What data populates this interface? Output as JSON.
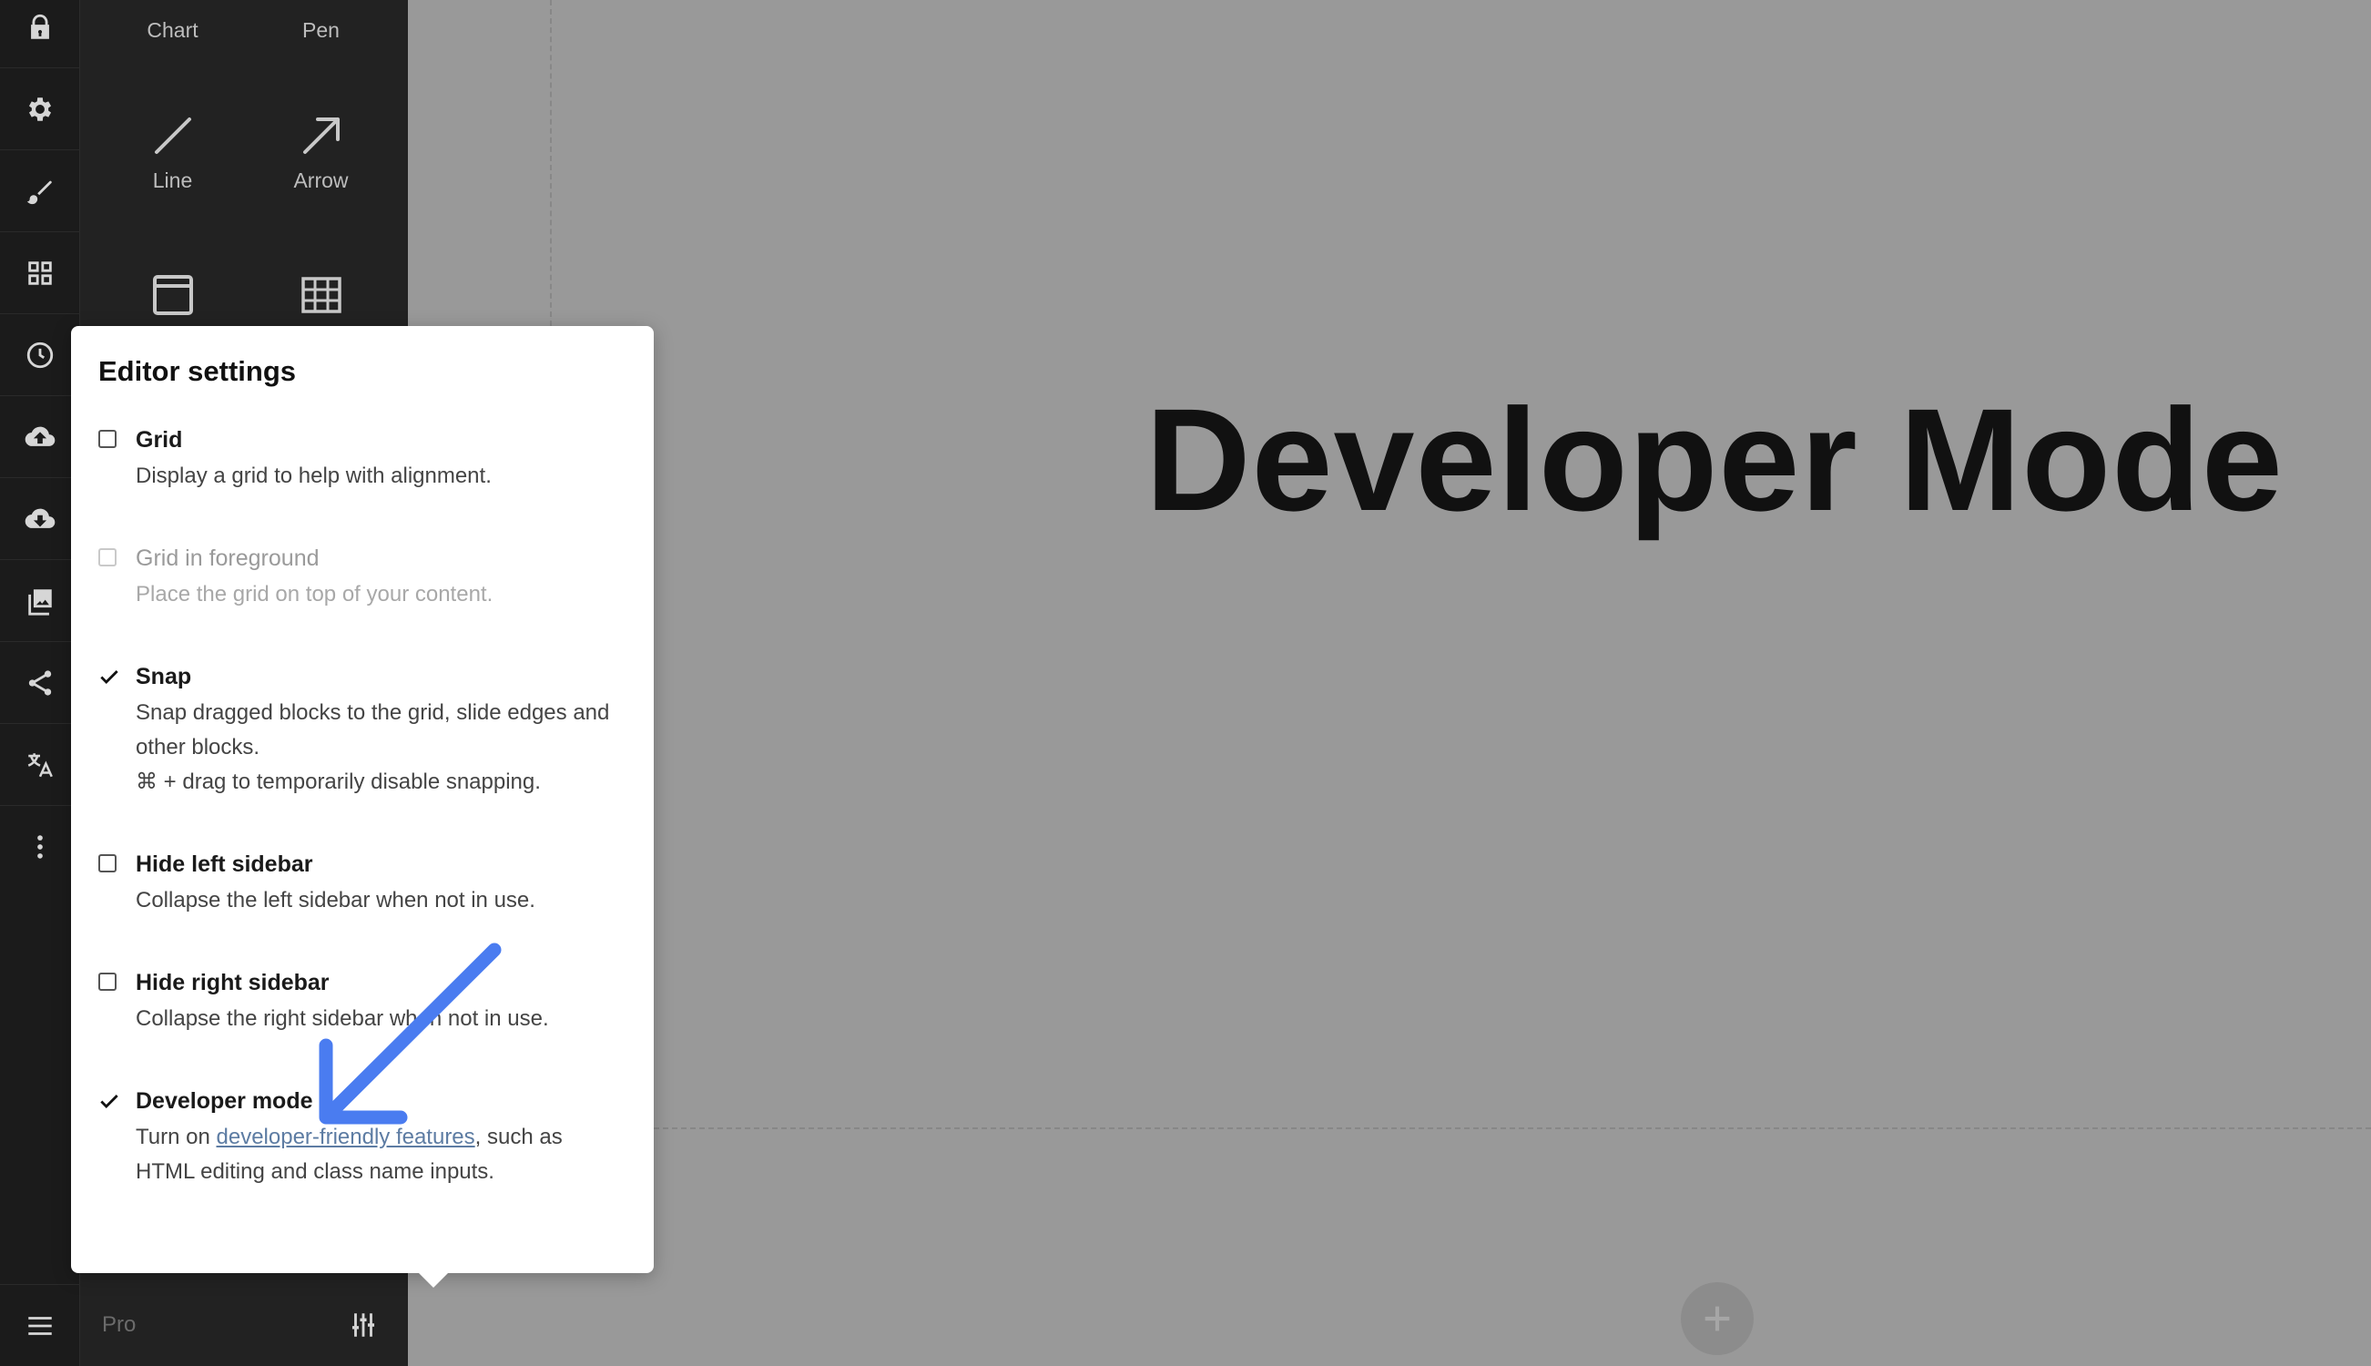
{
  "canvas": {
    "heading": "Developer Mode"
  },
  "tools": {
    "chart_label": "Chart",
    "pen_label": "Pen",
    "line_label": "Line",
    "arrow_label": "Arrow"
  },
  "footer": {
    "pro_label": "Pro"
  },
  "settings": {
    "title": "Editor settings",
    "options": [
      {
        "label": "Grid",
        "desc": "Display a grid to help with alignment.",
        "checked": false,
        "disabled": false
      },
      {
        "label": "Grid in foreground",
        "desc": "Place the grid on top of your content.",
        "checked": false,
        "disabled": true
      },
      {
        "label": "Snap",
        "desc": "Snap dragged blocks to the grid, slide edges and other blocks.",
        "desc2": "⌘ + drag to temporarily disable snapping.",
        "checked": true,
        "disabled": false
      },
      {
        "label": "Hide left sidebar",
        "desc": "Collapse the left sidebar when not in use.",
        "checked": false,
        "disabled": false
      },
      {
        "label": "Hide right sidebar",
        "desc": "Collapse the right sidebar when not in use.",
        "checked": false,
        "disabled": false
      },
      {
        "label": "Developer mode",
        "desc_pre": "Turn on ",
        "desc_link": "developer-friendly features",
        "desc_post": ", such as HTML editing and class name inputs.",
        "checked": true,
        "disabled": false
      }
    ]
  },
  "colors": {
    "annotation_arrow": "#4a7cf0",
    "canvas_bg": "#999999",
    "sidebar_bg": "#1b1b1b"
  }
}
